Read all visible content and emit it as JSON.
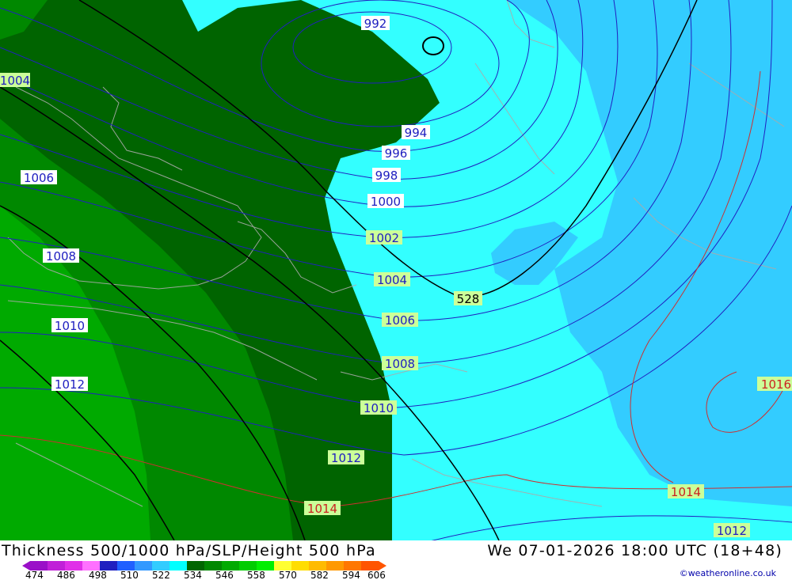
{
  "footer": {
    "title": "Thickness 500/1000 hPa/SLP/Height 500 hPa",
    "datetime": "We 07-01-2026 18:00 UTC (18+48)",
    "credit": "©weatheronline.co.uk"
  },
  "legend": {
    "ticks": [
      "474",
      "486",
      "498",
      "510",
      "522",
      "534",
      "546",
      "558",
      "570",
      "582",
      "594",
      "606"
    ],
    "colors": [
      "#9a10c8",
      "#c020d8",
      "#e030e8",
      "#ff70ff",
      "#2020c0",
      "#2060ff",
      "#3399ff",
      "#33ccff",
      "#00ffff",
      "#006600",
      "#008800",
      "#00aa00",
      "#00cc00",
      "#00ee00",
      "#ffff33",
      "#ffdd00",
      "#ffbb00",
      "#ff9900",
      "#ff7700",
      "#ff5500"
    ]
  },
  "isobars": {
    "labels": [
      {
        "text": "992",
        "color": "#2020c0"
      },
      {
        "text": "994",
        "color": "#2020c0"
      },
      {
        "text": "996",
        "color": "#2020c0"
      },
      {
        "text": "998",
        "color": "#2020c0"
      },
      {
        "text": "1000",
        "color": "#2020c0"
      },
      {
        "text": "1002",
        "color": "#2020c0"
      },
      {
        "text": "1004",
        "color": "#2020c0"
      },
      {
        "text": "1004",
        "color": "#2020c0"
      },
      {
        "text": "1006",
        "color": "#2020c0"
      },
      {
        "text": "1006",
        "color": "#2020c0"
      },
      {
        "text": "1008",
        "color": "#2020c0"
      },
      {
        "text": "1008",
        "color": "#2020c0"
      },
      {
        "text": "1010",
        "color": "#2020c0"
      },
      {
        "text": "1010",
        "color": "#2020c0"
      },
      {
        "text": "1012",
        "color": "#2020c0"
      },
      {
        "text": "1012",
        "color": "#2020c0"
      },
      {
        "text": "1012",
        "color": "#2020c0"
      },
      {
        "text": "1014",
        "color": "#cc2020"
      },
      {
        "text": "1014",
        "color": "#cc2020"
      },
      {
        "text": "1016",
        "color": "#cc2020"
      }
    ]
  },
  "height500": {
    "label": "528"
  },
  "colors": {
    "dark_green": "#006400",
    "mid_green": "#008800",
    "light_green": "#00aa00",
    "brighter_green": "#00b800",
    "cyan": "#33ffff",
    "light_blue": "#33ccff",
    "label_green_bg": "#ccff99",
    "label_white_bg": "#ffffff"
  }
}
